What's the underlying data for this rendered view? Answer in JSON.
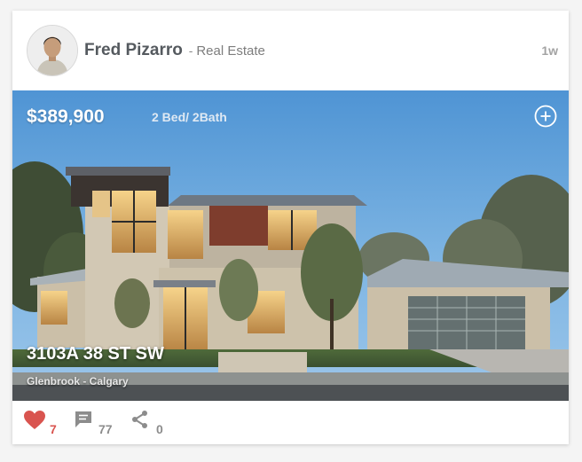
{
  "post": {
    "author_name": "Fred Pizarro",
    "separator": " - ",
    "author_role": "Real Estate",
    "time_ago": "1w"
  },
  "listing": {
    "price": "$389,900",
    "beds_baths": "2 Bed/ 2Bath",
    "address": "3103A 38 ST SW",
    "location": "Glenbrook - Calgary"
  },
  "actions": {
    "likes": "7",
    "comments": "77",
    "shares": "0"
  },
  "icons": {
    "add": "plus-circle-icon",
    "like": "heart-icon",
    "comment": "chat-bubble-icon",
    "share": "share-icon"
  },
  "colors": {
    "like_red": "#d9544f",
    "muted_gray": "#8c8c8c",
    "sky_blue": "#5c9fd6"
  }
}
